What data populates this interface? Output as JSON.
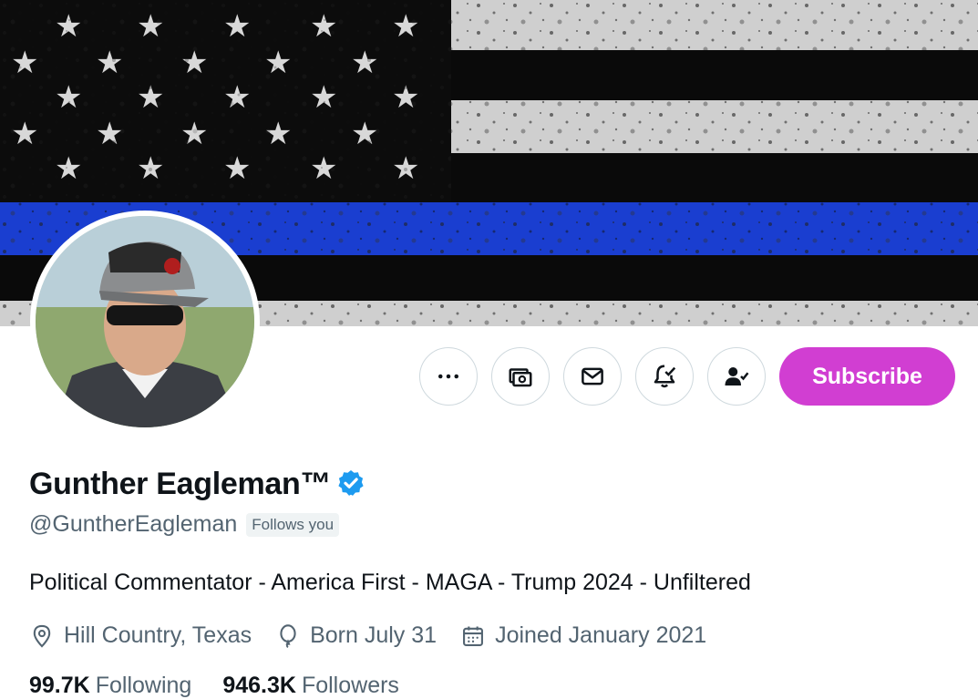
{
  "profile": {
    "display_name": "Gunther Eagleman™",
    "handle": "@GuntherEagleman",
    "follows_you_badge": "Follows you",
    "bio": "Political Commentator - America First - MAGA - Trump 2024 - Unfiltered",
    "location": "Hill Country, Texas",
    "birthday": "Born July 31",
    "joined": "Joined January 2021",
    "following_count": "99.7K",
    "following_label": "Following",
    "followers_count": "946.3K",
    "followers_label": "Followers",
    "verified": true
  },
  "actions": {
    "more_icon": "more-icon",
    "tip_icon": "money-icon",
    "message_icon": "envelope-icon",
    "notify_icon": "bell-check-icon",
    "following_icon": "person-check-icon",
    "subscribe_label": "Subscribe"
  },
  "colors": {
    "subscribe_bg": "#d13ed2",
    "verified_blue": "#1d9bf0",
    "muted_text": "#536471",
    "banner_blue_line": "#1133cc"
  },
  "banner": {
    "description_icon": "thin-blue-line-flag-image"
  }
}
